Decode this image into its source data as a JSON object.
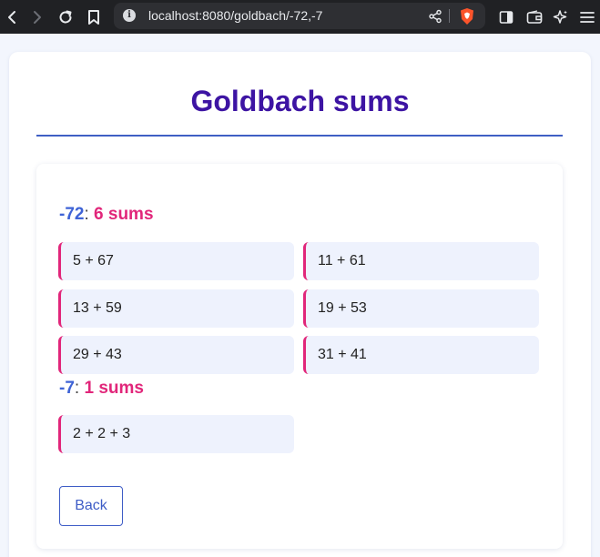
{
  "browser": {
    "url": "localhost:8080/goldbach/-72,-7"
  },
  "page": {
    "title": "Goldbach sums",
    "back_label": "Back"
  },
  "groups": [
    {
      "number": "-72",
      "separator": ":",
      "count_label": "6 sums",
      "sums": [
        "5 + 67",
        "11 + 61",
        "13 + 59",
        "19 + 53",
        "29 + 43",
        "31 + 41"
      ]
    },
    {
      "number": "-7",
      "separator": ":",
      "count_label": "1 sums",
      "sums": [
        "2 + 2 + 3"
      ]
    }
  ],
  "colors": {
    "title": "#3d14a3",
    "number": "#3e63d6",
    "count": "#e1267a",
    "accent_border": "#e1267a",
    "sum_background": "#eef2fd"
  }
}
